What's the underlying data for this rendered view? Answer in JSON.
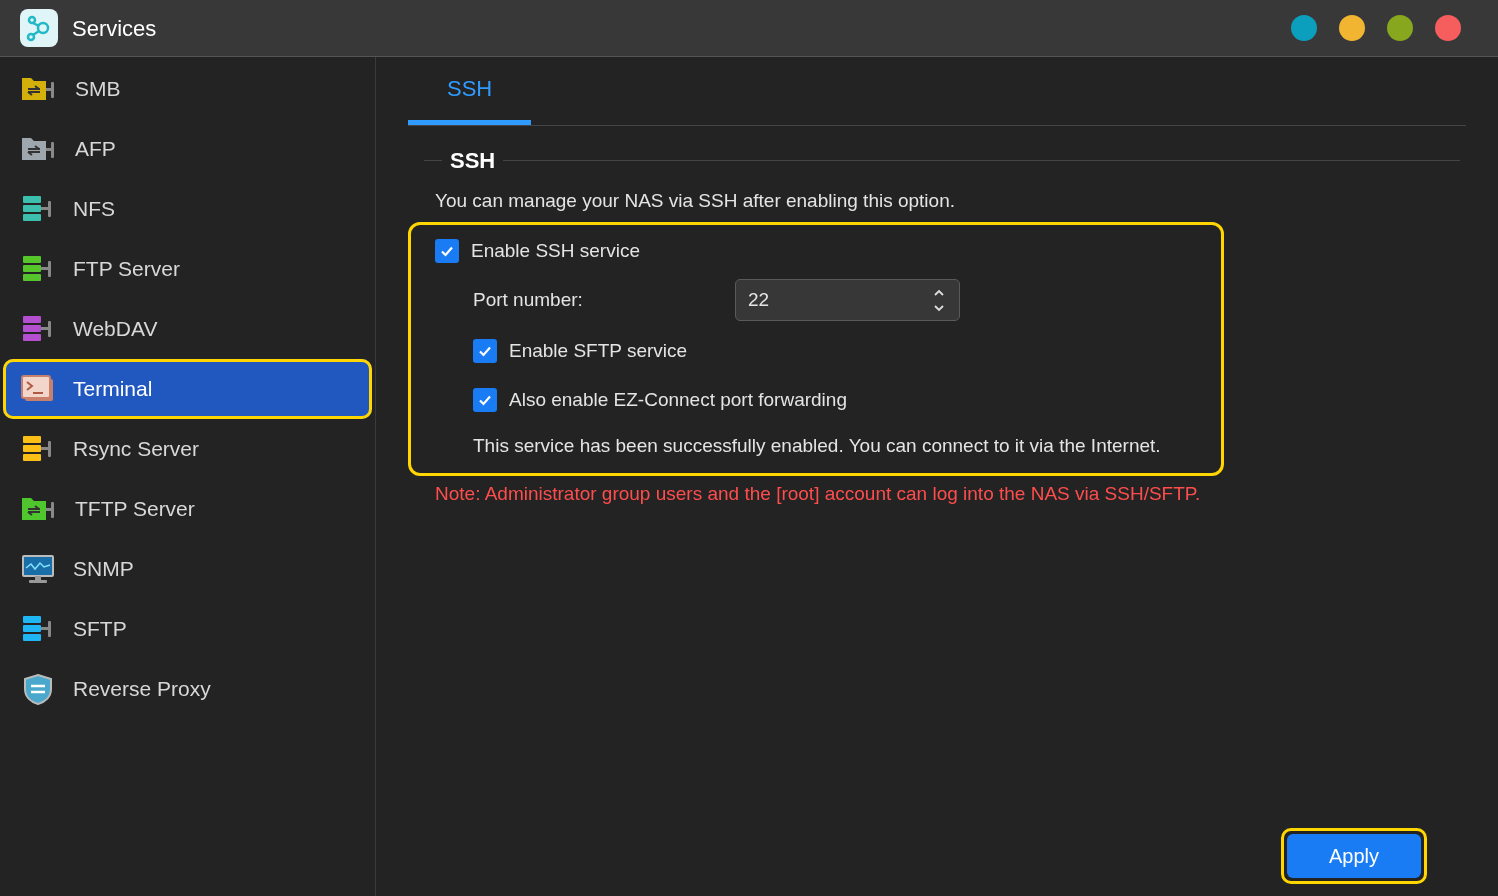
{
  "window": {
    "title": "Services",
    "dots": [
      {
        "color": "#0b9fbd"
      },
      {
        "color": "#f2b531"
      },
      {
        "color": "#87a71f"
      },
      {
        "color": "#f65d5d"
      }
    ]
  },
  "sidebar": {
    "items": [
      {
        "label": "SMB",
        "selected": false,
        "highlighted": false
      },
      {
        "label": "AFP",
        "selected": false,
        "highlighted": false
      },
      {
        "label": "NFS",
        "selected": false,
        "highlighted": false
      },
      {
        "label": "FTP Server",
        "selected": false,
        "highlighted": false
      },
      {
        "label": "WebDAV",
        "selected": false,
        "highlighted": false
      },
      {
        "label": "Terminal",
        "selected": true,
        "highlighted": true
      },
      {
        "label": "Rsync Server",
        "selected": false,
        "highlighted": false
      },
      {
        "label": "TFTP Server",
        "selected": false,
        "highlighted": false
      },
      {
        "label": "SNMP",
        "selected": false,
        "highlighted": false
      },
      {
        "label": "SFTP",
        "selected": false,
        "highlighted": false
      },
      {
        "label": "Reverse Proxy",
        "selected": false,
        "highlighted": false
      }
    ]
  },
  "tabs": [
    {
      "label": "SSH",
      "selected": true
    }
  ],
  "section": {
    "title": "SSH",
    "description": "You can manage your NAS via SSH after enabling this option.",
    "options": {
      "highlighted": true,
      "enable_ssh": {
        "label": "Enable SSH service",
        "checked": true
      },
      "port": {
        "label": "Port number:",
        "value": "22"
      },
      "enable_sftp": {
        "label": "Enable SFTP service",
        "checked": true
      },
      "ez_connect": {
        "label": "Also enable EZ-Connect port forwarding",
        "checked": true
      },
      "status": "This service has been successfully enabled. You can connect to it via the Internet."
    },
    "note": "Note: Administrator group users and the [root] account can log into the NAS via SSH/SFTP."
  },
  "apply_button": {
    "label": "Apply",
    "highlighted": true
  }
}
